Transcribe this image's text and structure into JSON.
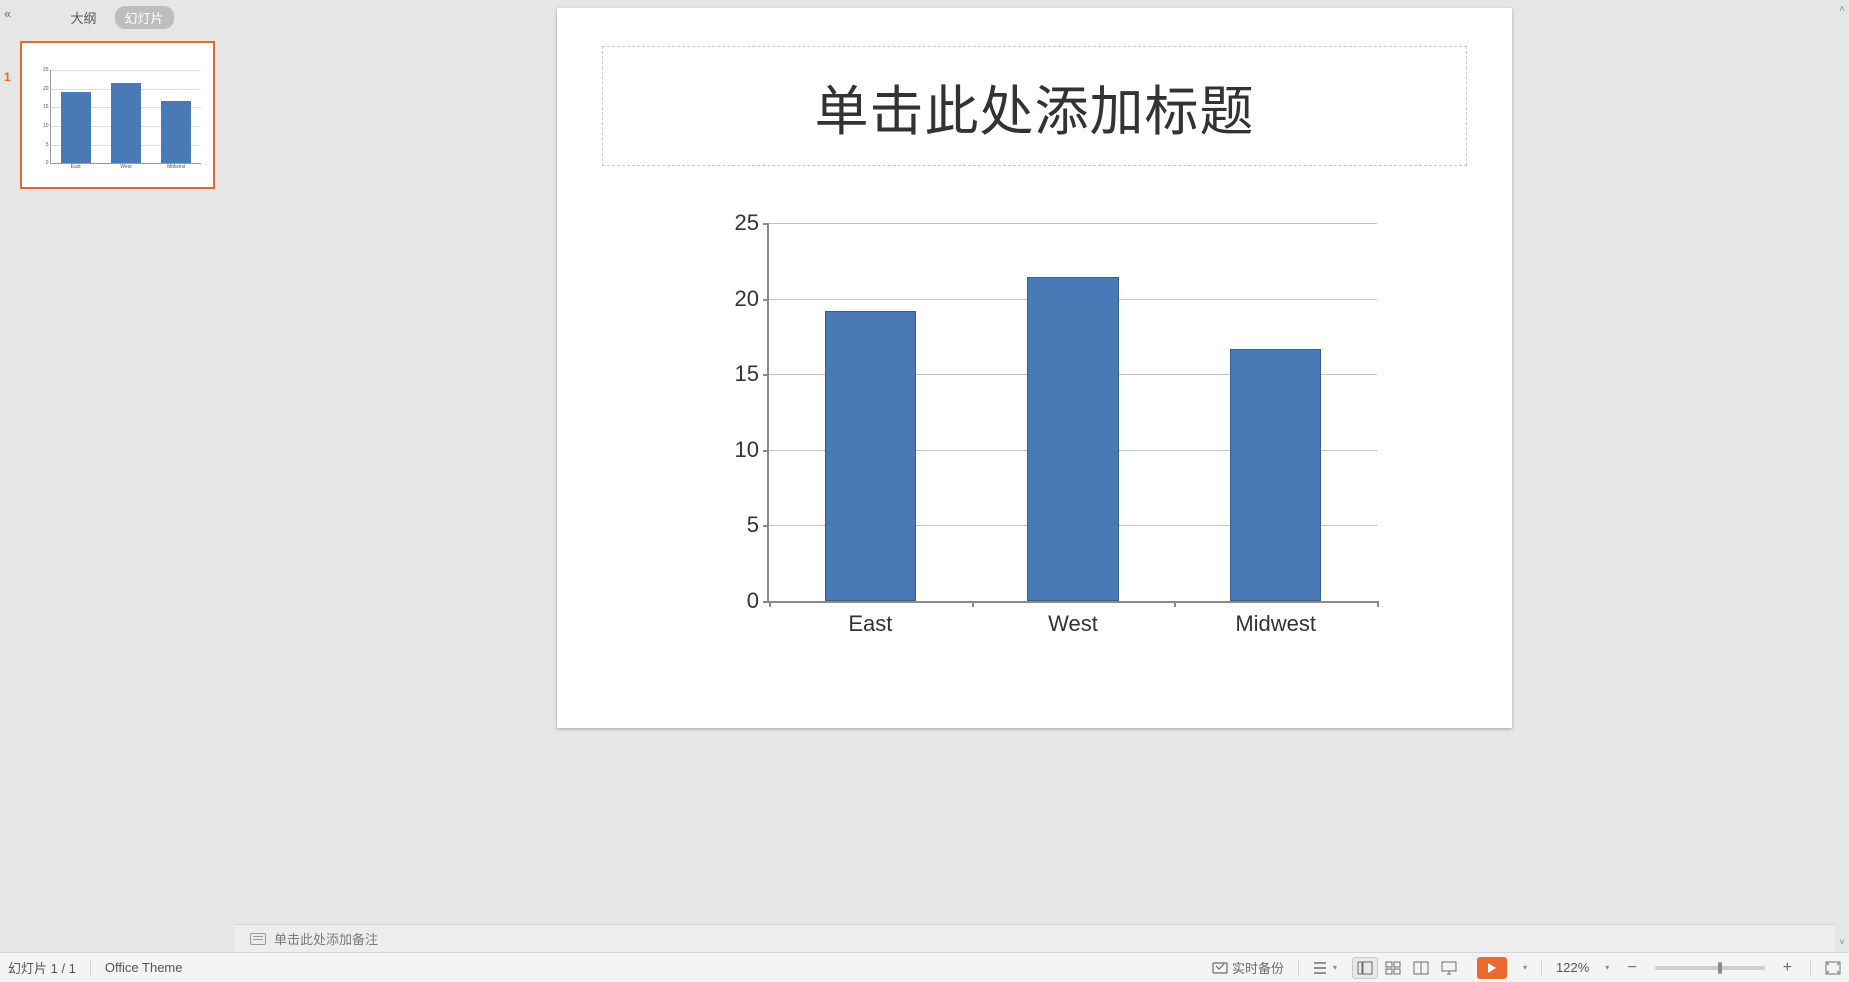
{
  "sidebar": {
    "tab_outline": "大纲",
    "tab_slides": "幻灯片",
    "slide_number": "1"
  },
  "slide": {
    "title_placeholder": "单击此处添加标题"
  },
  "chart_data": {
    "type": "bar",
    "categories": [
      "East",
      "West",
      "Midwest"
    ],
    "values": [
      19.2,
      21.4,
      16.7
    ],
    "title": "",
    "xlabel": "",
    "ylabel": "",
    "ylim": [
      0,
      25
    ],
    "yticks": [
      0,
      5,
      10,
      15,
      20,
      25
    ]
  },
  "notes": {
    "placeholder": "单击此处添加备注"
  },
  "status": {
    "slide_counter": "幻灯片 1 / 1",
    "theme": "Office Theme",
    "backup_label": "实时备份",
    "zoom_level": "122%"
  }
}
